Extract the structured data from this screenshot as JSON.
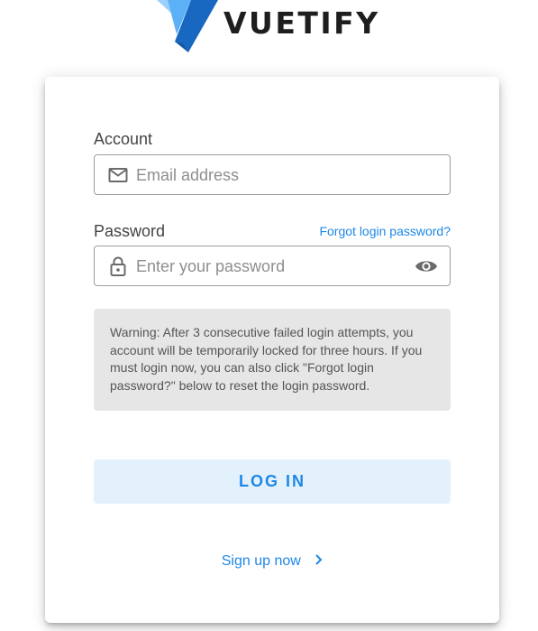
{
  "brand": {
    "name": "VUETIFY",
    "colors": {
      "logo_light": "#7fc4fd",
      "logo_mid": "#2196f3",
      "logo_dark": "#1867c0",
      "text": "#1e1e1e"
    }
  },
  "form": {
    "account": {
      "label": "Account",
      "placeholder": "Email address",
      "icon": "mail-icon"
    },
    "password": {
      "label": "Password",
      "placeholder": "Enter your password",
      "icon": "lock-icon",
      "toggle_icon": "eye-icon",
      "forgot_link": "Forgot login password?"
    },
    "warning": "Warning: After 3 consecutive failed login attempts, you account will be temporarily locked for three hours. If you must login now, you can also click \"Forgot login password?\" below to reset the login password.",
    "login_button": "LOG IN",
    "signup_link": "Sign up now",
    "accent_color": "#1e88e5"
  }
}
